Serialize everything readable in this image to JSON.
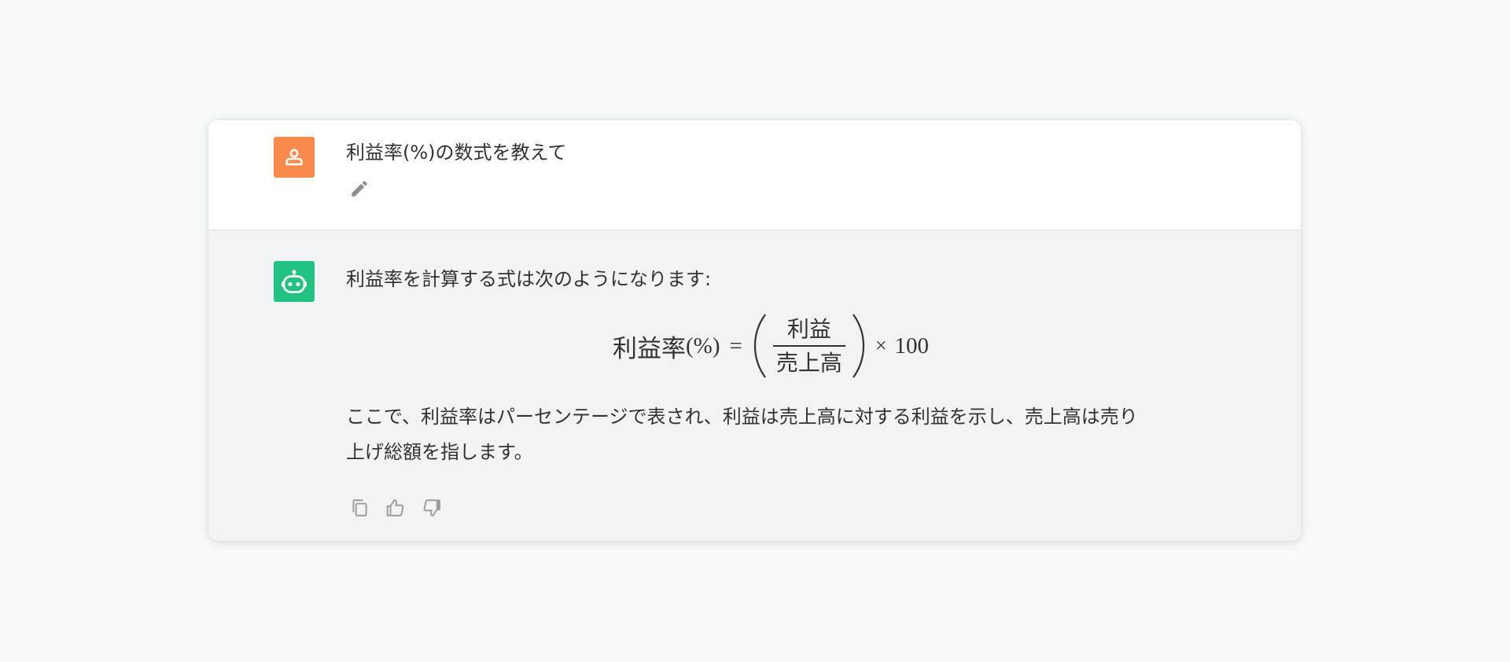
{
  "conversation": {
    "user_message": {
      "text": "利益率(%)の数式を教えて",
      "avatar_icon": "user-icon",
      "avatar_color": "#f98a4b",
      "edit_icon": "pencil-icon"
    },
    "bot_message": {
      "avatar_icon": "robot-icon",
      "avatar_color": "#22c283",
      "intro": "利益率を計算する式は次のようになります:",
      "formula": {
        "lhs_label": "利益率",
        "lhs_unit": "(%)",
        "equals": "=",
        "numerator": "利益",
        "denominator": "売上高",
        "times": "×",
        "multiplier": "100"
      },
      "paragraph_line1": "ここで、利益率はパーセンテージで表され、利益は売上高に対する利益を示し、売上高は売り",
      "paragraph_line2": "上げ総額を指します。",
      "actions": [
        "copy-icon",
        "thumbs-up-icon",
        "thumbs-down-icon"
      ]
    }
  }
}
